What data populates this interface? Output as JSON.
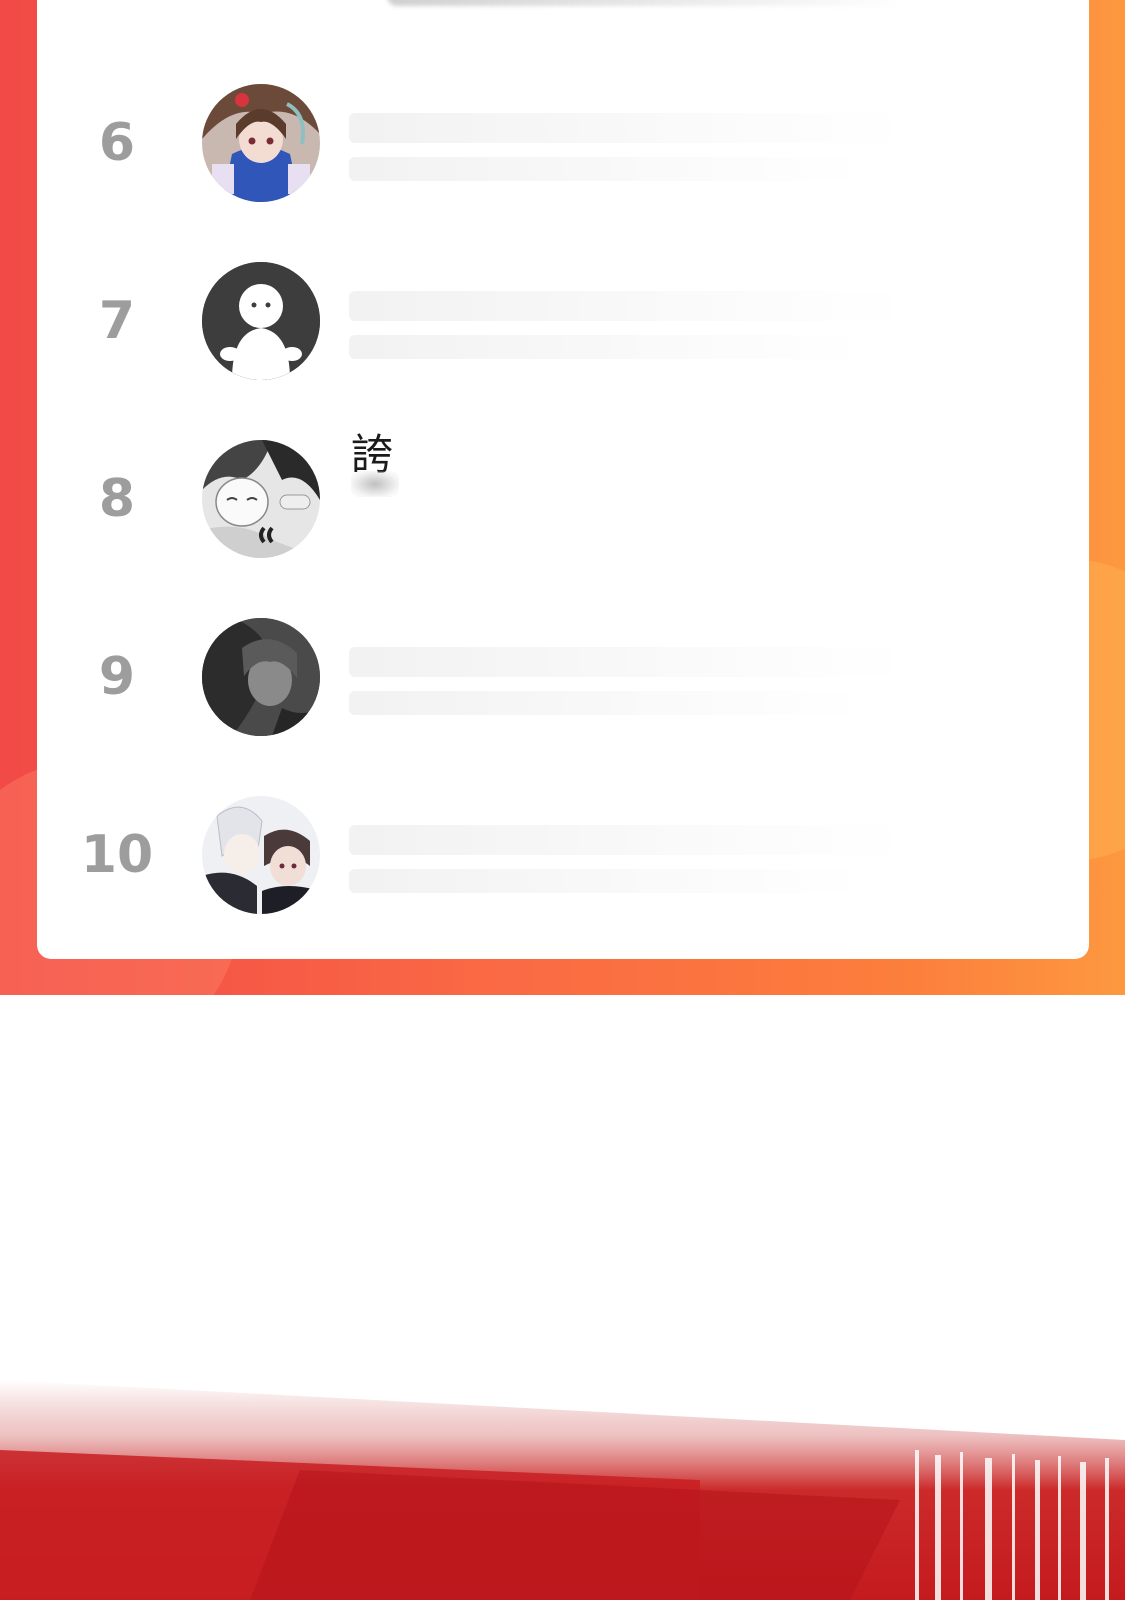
{
  "colors": {
    "banner_start": "#f24a47",
    "banner_end": "#fd9840",
    "rank_color": "#9d9d9d",
    "card_bg": "#ffffff",
    "bottom_red": "#c41a1e"
  },
  "leaderboard": {
    "rows": [
      {
        "rank": "6",
        "name": "",
        "avatar_icon": "anime-girl-avatar-icon"
      },
      {
        "rank": "7",
        "name": "",
        "avatar_icon": "default-user-avatar-icon"
      },
      {
        "rank": "8",
        "name": "誇",
        "avatar_icon": "anime-couple-avatar-icon"
      },
      {
        "rank": "9",
        "name": "",
        "avatar_icon": "dark-anime-avatar-icon"
      },
      {
        "rank": "10",
        "name": "",
        "avatar_icon": "anime-duo-avatar-icon"
      }
    ]
  }
}
